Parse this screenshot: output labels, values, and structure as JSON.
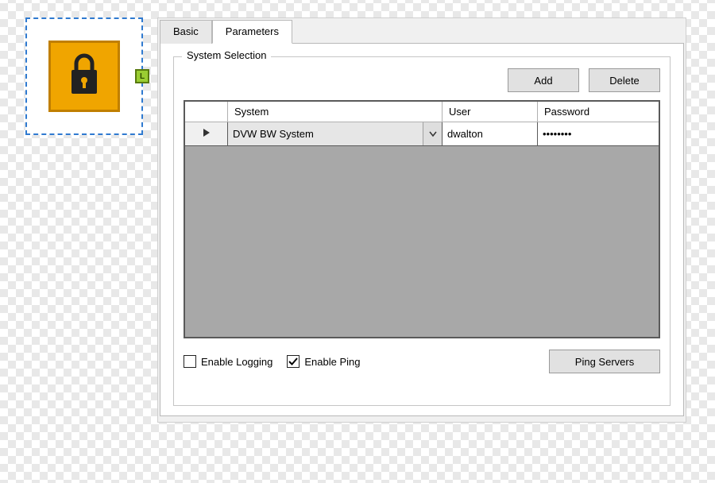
{
  "node": {
    "port_label": "L"
  },
  "tabs": {
    "basic": "Basic",
    "parameters": "Parameters",
    "active": "parameters"
  },
  "groupbox": {
    "legend": "System Selection"
  },
  "buttons": {
    "add": "Add",
    "delete": "Delete",
    "ping": "Ping Servers"
  },
  "grid": {
    "headers": {
      "handle": "",
      "system": "System",
      "user": "User",
      "password": "Password"
    },
    "rows": [
      {
        "system": "DVW BW System",
        "user": "dwalton",
        "password_mask": "••••••••"
      }
    ]
  },
  "checks": {
    "enable_logging": {
      "label": "Enable Logging",
      "checked": false
    },
    "enable_ping": {
      "label": "Enable Ping",
      "checked": true
    }
  }
}
